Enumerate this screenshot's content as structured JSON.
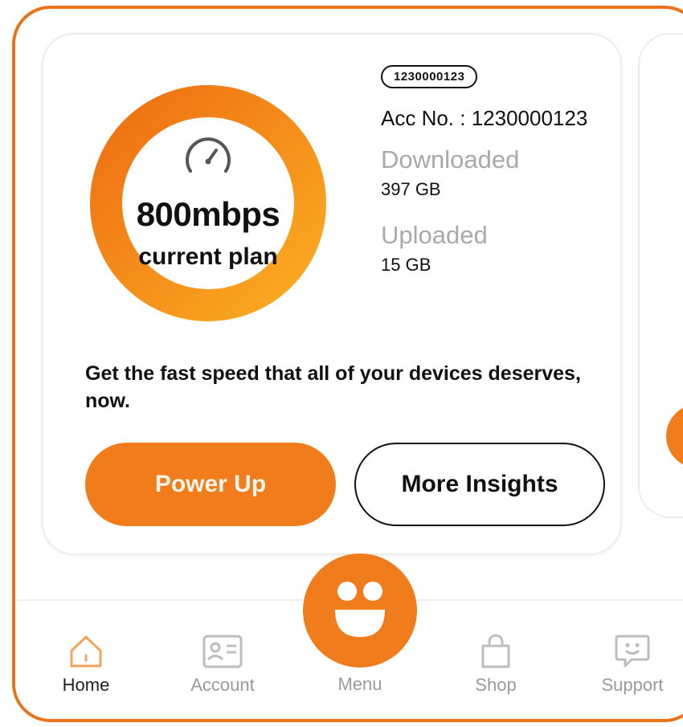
{
  "plan": {
    "speed": "800mbps",
    "speed_label": "current plan",
    "account_badge": "1230000123",
    "account_line": "Acc No. : 1230000123",
    "downloaded_label": "Downloaded",
    "downloaded_value": "397 GB",
    "uploaded_label": "Uploaded",
    "uploaded_value": "15 GB",
    "promo_text": "Get the fast speed that all of your devices deserves, now.",
    "primary_button": "Power Up",
    "secondary_button": "More Insights",
    "ring_icon": "speedometer-icon"
  },
  "nav": {
    "items": [
      {
        "label": "Home",
        "icon": "home-icon",
        "active": true
      },
      {
        "label": "Account",
        "icon": "id-card-icon",
        "active": false
      },
      {
        "label": "Menu",
        "icon": "smiley-icon",
        "active": false
      },
      {
        "label": "Shop",
        "icon": "shopping-bag-icon",
        "active": false
      },
      {
        "label": "Support",
        "icon": "chat-bubble-smiley-icon",
        "active": false
      }
    ]
  },
  "colors": {
    "accent": "#f07c1c",
    "accent_light": "#f9a21b",
    "frame_border": "#e8731a",
    "muted_text": "#a9a9a9"
  }
}
